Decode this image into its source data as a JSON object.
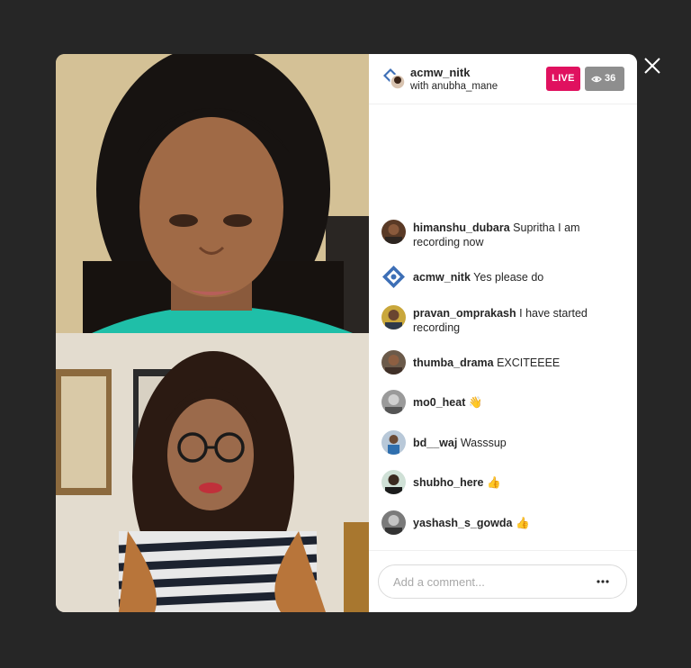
{
  "header": {
    "host_username": "acmw_nitk",
    "cohost_text": "with anubha_mane",
    "live_label": "LIVE",
    "viewer_count": "36"
  },
  "comments": [
    {
      "user": "himanshu_dubara",
      "text": "Supritha I am recording now"
    },
    {
      "user": "acmw_nitk",
      "text": "Yes please do"
    },
    {
      "user": "pravan_omprakash",
      "text": "I have started recording"
    },
    {
      "user": "thumba_drama",
      "text": "EXCITEEEE"
    },
    {
      "user": "mo0_heat",
      "text": "👋"
    },
    {
      "user": "bd__waj",
      "text": "Wasssup"
    },
    {
      "user": "shubho_here",
      "text": "👍"
    },
    {
      "user": "yashash_s_gowda",
      "text": "👍"
    }
  ],
  "composer": {
    "placeholder": "Add a comment..."
  },
  "icons": {
    "close": "close-icon",
    "eye": "eye-icon",
    "more": "more-icon"
  },
  "colors": {
    "live": "#e0115f",
    "viewers": "#8e8e8e",
    "backdrop": "#262626"
  }
}
